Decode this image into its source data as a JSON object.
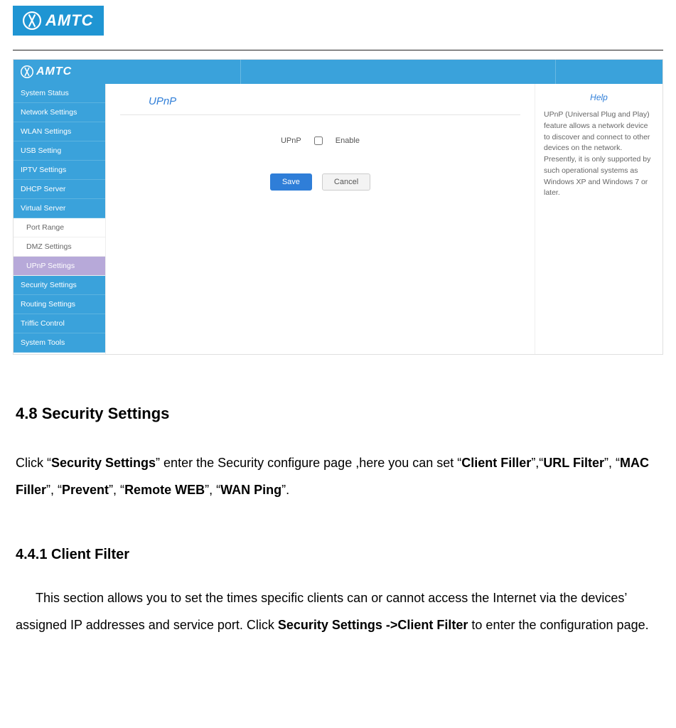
{
  "brand": "AMTC",
  "screenshot": {
    "sidebar": [
      {
        "label": "System Status",
        "type": "item"
      },
      {
        "label": "Network Settings",
        "type": "item"
      },
      {
        "label": "WLAN Settings",
        "type": "item"
      },
      {
        "label": "USB Setting",
        "type": "item"
      },
      {
        "label": "IPTV Settings",
        "type": "item"
      },
      {
        "label": "DHCP Server",
        "type": "item"
      },
      {
        "label": "Virtual Server",
        "type": "item"
      },
      {
        "label": "Port Range",
        "type": "sub"
      },
      {
        "label": "DMZ Settings",
        "type": "sub"
      },
      {
        "label": "UPnP Settings",
        "type": "sub-active"
      },
      {
        "label": "Security Settings",
        "type": "item"
      },
      {
        "label": "Routing Settings",
        "type": "item"
      },
      {
        "label": "Triffic Control",
        "type": "item"
      },
      {
        "label": "System Tools",
        "type": "item"
      }
    ],
    "panel": {
      "title": "UPnP",
      "field_label": "UPnP",
      "checkbox_label": "Enable",
      "save": "Save",
      "cancel": "Cancel"
    },
    "help": {
      "title": "Help",
      "text": "UPnP (Universal Plug and Play) feature allows a network device to discover and connect to other devices on the network. Presently, it is only supported by such operational systems as Windows XP and Windows 7 or later."
    }
  },
  "doc": {
    "h1": "4.8 Security Settings",
    "p1_a": "Click “",
    "p1_b": "Security Settings",
    "p1_c": "” enter the Security configure page ,here you can set “",
    "p1_d": "Client Filler",
    "p1_e": "”,“",
    "p1_f": "URL Filter",
    "p1_g": "”, “",
    "p1_h": "MAC Filler",
    "p1_i": "”, “",
    "p1_j": "Prevent",
    "p1_k": "”, “",
    "p1_l": "Remote WEB",
    "p1_m": "”, “",
    "p1_n": "WAN Ping",
    "p1_o": "”.",
    "h2": "4.4.1 Client Filter",
    "p2_a": "This section allows you to set the times specific clients can or cannot access the Internet via the devices’ assigned IP addresses and service port. Click ",
    "p2_b": "Security Settings ->Client Filter",
    "p2_c": " to enter the configuration page."
  }
}
